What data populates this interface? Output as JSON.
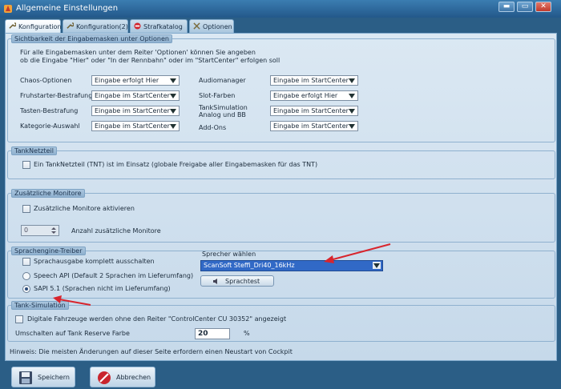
{
  "window": {
    "title": "Allgemeine Einstellungen",
    "controls": {
      "minimize": "▬",
      "restore": "▭",
      "close": "✕"
    }
  },
  "tabs": [
    "Konfiguration",
    "Konfiguration(2)",
    "Strafkatalog",
    "Optionen"
  ],
  "sichtbarkeit": {
    "legend": "Sichtbarkeit der Eingabemasken unter Optionen",
    "desc1": "Für alle Eingabemasken unter dem Reiter 'Optionen' können Sie angeben",
    "desc2": "ob die Eingabe \"Hier\" oder \"In der Rennbahn\" oder im \"StartCenter\" erfolgen soll",
    "rows": [
      {
        "label": "Chaos-Optionen",
        "value": "Eingabe erfolgt Hier"
      },
      {
        "label": "Fruhstarter-Bestrafung",
        "value": "Eingabe im StartCenter"
      },
      {
        "label": "Tasten-Bestrafung",
        "value": "Eingabe im StartCenter"
      },
      {
        "label": "Kategorie-Auswahl",
        "value": "Eingabe im StartCenter"
      }
    ],
    "rows_right": [
      {
        "label": "Audiomanager",
        "value": "Eingabe im StartCenter"
      },
      {
        "label": "Slot-Farben",
        "value": "Eingabe erfolgt Hier"
      },
      {
        "label": "TankSimulation",
        "label2": "Analog und BB",
        "value": "Eingabe im StartCenter"
      },
      {
        "label": "Add-Ons",
        "value": "Eingabe im StartCenter"
      }
    ]
  },
  "tanknetzteil": {
    "legend": "TankNetzteil",
    "checkbox": "Ein TankNetzteil (TNT) ist im Einsatz (globale Freigabe aller Eingabemasken für das TNT)"
  },
  "monitore": {
    "legend": "Zusätzliche Monitore",
    "checkbox": "Zusätzliche Monitore aktivieren",
    "spin_value": "0",
    "spin_label": "Anzahl zusätzliche Monitore"
  },
  "sprachengine": {
    "legend": "Sprachengine-Treiber",
    "checkbox": "Sprachausgabe komplett ausschalten",
    "radio1": "Speech API  (Default 2 Sprachen im Lieferumfang)",
    "radio2": "SAPI 5.1  (Sprachen nicht im Lieferumfang)",
    "sprecher_label": "Sprecher wählen",
    "sprecher_value": "ScanSoft Steffi_Dri40_16kHz",
    "sprachtest": "Sprachtest"
  },
  "tanksim": {
    "legend": "Tank-Simulation",
    "checkbox": "Digitale Fahrzeuge werden ohne den Reiter \"ControlCenter CU 30352\" angezeigt",
    "reserve_label": "Umschalten auf Tank Reserve Farbe",
    "reserve_value": "20",
    "percent": "%"
  },
  "hint": "Hinweis:  Die meisten Änderungen auf dieser Seite erfordern einen Neustart von Cockpit",
  "buttons": {
    "save": "Speichern",
    "cancel": "Abbrechen"
  },
  "colors": {
    "accent": "#3169c6",
    "arrow": "#d8252d",
    "titlebar": "#2b5e86"
  }
}
